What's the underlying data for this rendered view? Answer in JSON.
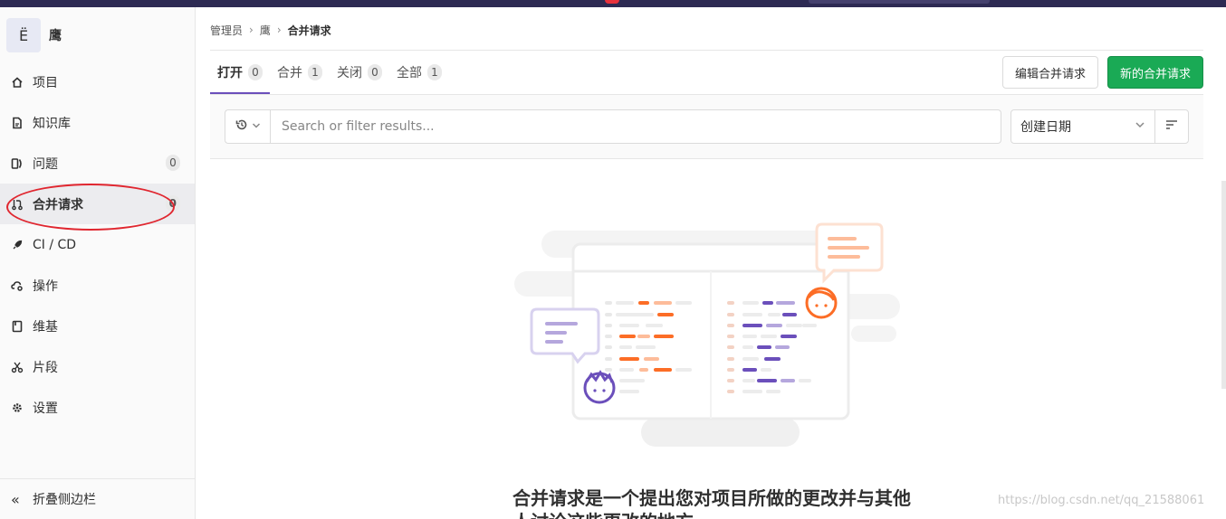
{
  "project": {
    "avatar_letter": "Ë",
    "name": "鹰"
  },
  "sidebar": {
    "items": [
      {
        "label": "项目",
        "icon": "home-icon"
      },
      {
        "label": "知识库",
        "icon": "document-icon"
      },
      {
        "label": "问题",
        "icon": "issues-icon",
        "badge": "0"
      },
      {
        "label": "合并请求",
        "icon": "merge-request-icon",
        "badge": "0",
        "active": true
      },
      {
        "label": "CI / CD",
        "icon": "rocket-icon"
      },
      {
        "label": "操作",
        "icon": "cloud-gear-icon"
      },
      {
        "label": "维基",
        "icon": "book-icon"
      },
      {
        "label": "片段",
        "icon": "scissors-icon"
      },
      {
        "label": "设置",
        "icon": "gear-icon"
      }
    ],
    "collapse_label": "折叠侧边栏",
    "collapse_icon": "double-chevron-left-icon"
  },
  "breadcrumb": {
    "items": [
      "管理员",
      "鹰",
      "合并请求"
    ]
  },
  "tabs": [
    {
      "label": "打开",
      "count": "0",
      "active": true
    },
    {
      "label": "合并",
      "count": "1"
    },
    {
      "label": "关闭",
      "count": "0"
    },
    {
      "label": "全部",
      "count": "1"
    }
  ],
  "buttons": {
    "edit_label": "编辑合并请求",
    "new_label": "新的合并请求"
  },
  "filter": {
    "placeholder": "Search or filter results...",
    "sort_value": "创建日期"
  },
  "empty_state": {
    "title": "合并请求是一个提出您对项目所做的更改并与其他人讨论这些更改的地方"
  },
  "watermark": "https://blog.csdn.net/qq_21588061",
  "colors": {
    "accent": "#6b4fbb",
    "success": "#1aaa55",
    "topbar": "#2d2a53",
    "annotation": "#e0262f"
  }
}
